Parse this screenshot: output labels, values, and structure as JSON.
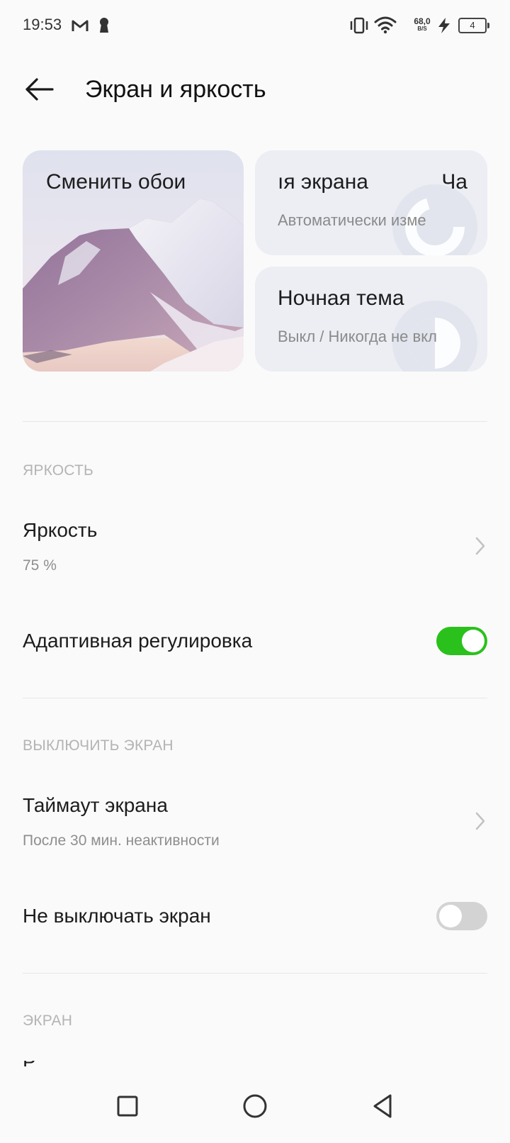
{
  "status_bar": {
    "time": "19:53",
    "net_speed_value": "68,0",
    "net_speed_unit": "B/S",
    "battery_level": "4"
  },
  "header": {
    "title": "Экран и яркость"
  },
  "cards": {
    "wallpaper_label": "Сменить обои",
    "refresh_title_start": "ıя экрана",
    "refresh_title_end": "Ча",
    "refresh_subtitle": "Автоматически изме",
    "night_theme_title": "Ночная тема",
    "night_theme_subtitle": "Выкл / Никогда не вкл"
  },
  "sections": {
    "brightness_header": "ЯРКОСТЬ",
    "screen_off_header": "ВЫКЛЮЧИТЬ ЭКРАН",
    "display_header": "ЭКРАН"
  },
  "rows": {
    "brightness_title": "Яркость",
    "brightness_value": "75 %",
    "adaptive_title": "Адаптивная регулировка",
    "timeout_title": "Таймаут экрана",
    "timeout_value": "После 30 мин. неактивности",
    "keep_on_title": "Не выключать экран",
    "partial_row_title": "Р"
  },
  "toggles": {
    "adaptive_on": true,
    "keep_on_on": false
  },
  "colors": {
    "toggle_on": "#2ac11c",
    "toggle_off": "#d3d3d3",
    "card_bg": "#eceef4"
  },
  "icons": {
    "status": [
      "gmail-icon",
      "keyhole-icon",
      "vibrate-icon",
      "wifi-icon",
      "charging-icon",
      "battery-icon"
    ],
    "nav": [
      "recents-square-icon",
      "home-circle-icon",
      "back-triangle-icon"
    ]
  }
}
